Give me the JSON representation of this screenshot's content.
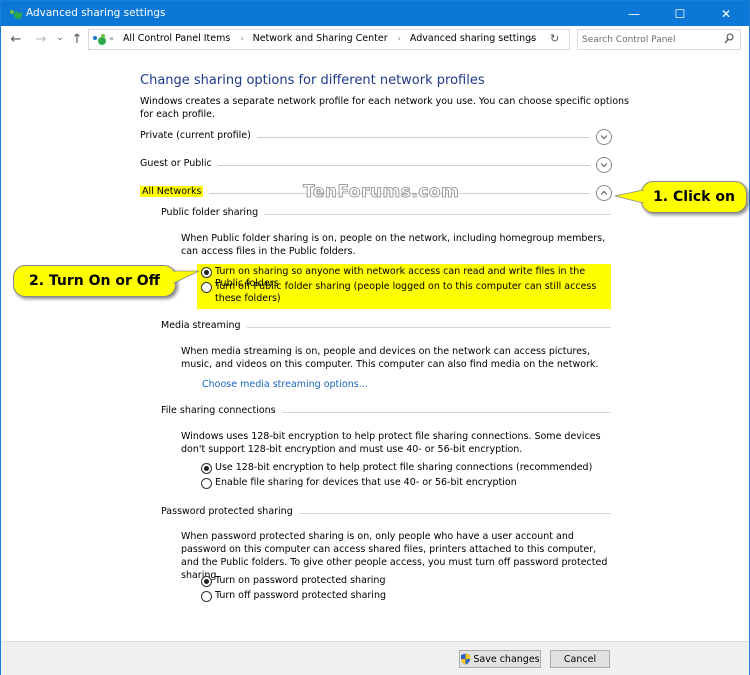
{
  "window": {
    "title": "Advanced sharing settings",
    "accent": "#0b78d7",
    "controls": {
      "minimize": "—",
      "maximize": "☐",
      "close": "✕"
    }
  },
  "navigation": {
    "back": "←",
    "forward": "→",
    "recent": "⌄",
    "up": "↑",
    "breadcrumb": {
      "overflow": "«",
      "items": [
        "All Control Panel Items",
        "Network and Sharing Center",
        "Advanced sharing settings"
      ],
      "separator": "›"
    },
    "dropdown": "⌄",
    "refresh": "↻",
    "search": {
      "placeholder": "Search Control Panel"
    }
  },
  "main": {
    "heading": "Change sharing options for different network profiles",
    "intro": "Windows creates a separate network profile for each network you use. You can choose specific options for each profile.",
    "profiles": [
      {
        "label": "Private (current profile)",
        "expanded": false
      },
      {
        "label": "Guest or Public",
        "expanded": false
      },
      {
        "label": "All Networks",
        "expanded": true,
        "highlighted": true
      }
    ],
    "sections": {
      "public_folder": {
        "title": "Public folder sharing",
        "description": "When Public folder sharing is on, people on the network, including homegroup members, can access files in the Public folders.",
        "options": [
          {
            "label": "Turn on sharing so anyone with network access can read and write files in the Public folders",
            "checked": true
          },
          {
            "label": "Turn off Public folder sharing (people logged on to this computer can still access these folders)",
            "checked": false
          }
        ]
      },
      "media_streaming": {
        "title": "Media streaming",
        "description": "When media streaming is on, people and devices on the network can access pictures, music, and videos on this computer. This computer can also find media on the network.",
        "link": "Choose media streaming options..."
      },
      "file_sharing": {
        "title": "File sharing connections",
        "description": "Windows uses 128-bit encryption to help protect file sharing connections. Some devices don't support 128-bit encryption and must use 40- or 56-bit encryption.",
        "options": [
          {
            "label": "Use 128-bit encryption to help protect file sharing connections (recommended)",
            "checked": true
          },
          {
            "label": "Enable file sharing for devices that use 40- or 56-bit encryption",
            "checked": false
          }
        ]
      },
      "password": {
        "title": "Password protected sharing",
        "description": "When password protected sharing is on, only people who have a user account and password on this computer can access shared files, printers attached to this computer, and the Public folders. To give other people access, you must turn off password protected sharing.",
        "options": [
          {
            "label": "Turn on password protected sharing",
            "checked": true
          },
          {
            "label": "Turn off password protected sharing",
            "checked": false
          }
        ]
      }
    }
  },
  "footer": {
    "save": "Save changes",
    "cancel": "Cancel"
  },
  "annotations": {
    "watermark": "TenForums.com",
    "callout1": "1. Click on",
    "callout2": "2. Turn On or Off",
    "highlight_color": "#ffff00"
  }
}
